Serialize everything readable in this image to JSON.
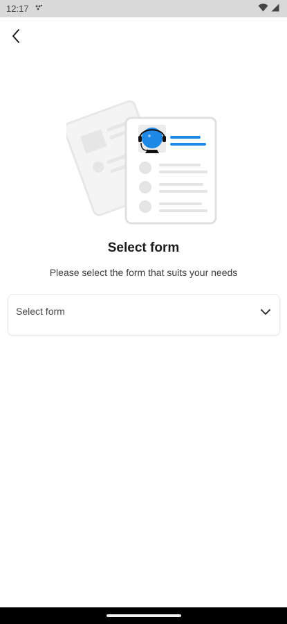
{
  "status_bar": {
    "time": "12:17",
    "notification_icons": "notification-dots",
    "wifi_icon": "wifi-icon",
    "signal_icon": "signal-icon"
  },
  "header": {
    "back_icon": "back-arrow-icon"
  },
  "illustration": {
    "name": "support-form-illustration",
    "accent_color": "#1e88e5"
  },
  "main": {
    "title": "Select form",
    "subtitle": "Please select the form that suits your needs"
  },
  "form_select": {
    "value": "Select form",
    "chevron_icon": "chevron-down-icon"
  },
  "navigation": {
    "home_indicator": "home-indicator"
  }
}
